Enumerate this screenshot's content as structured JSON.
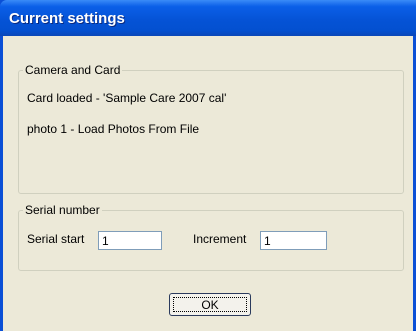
{
  "window": {
    "title": "Current settings"
  },
  "camera_group": {
    "legend": "Camera and Card",
    "card_line": "Card loaded - 'Sample Care 2007 cal'",
    "photo_line": "photo 1 - Load Photos From File"
  },
  "serial_group": {
    "legend": "Serial number",
    "start_label": "Serial start",
    "start_value": "1",
    "increment_label": "Increment",
    "increment_value": "1"
  },
  "buttons": {
    "ok_label": "OK"
  },
  "colors": {
    "titlebar": "#0553d6",
    "client": "#ece9d8",
    "window_frame": "#0a4fd6"
  }
}
